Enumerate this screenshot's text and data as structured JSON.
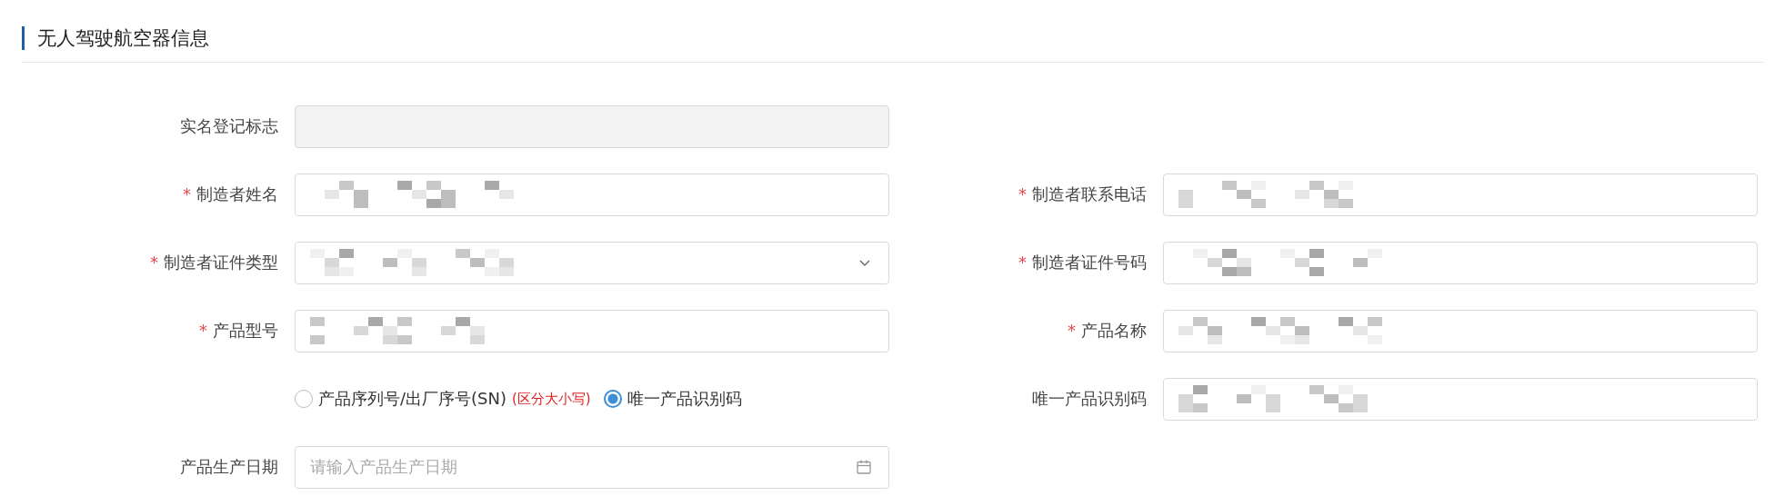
{
  "section": {
    "title": "无人驾驶航空器信息"
  },
  "rows": [
    {
      "left": {
        "kind": "disabled",
        "label": "实名登记标志"
      }
    },
    {
      "left": {
        "kind": "text",
        "label": "制造者姓名",
        "required_mark": "*",
        "masked": true
      },
      "right": {
        "kind": "text",
        "label": "制造者联系电话",
        "required_mark": "*",
        "masked": true
      }
    },
    {
      "left": {
        "kind": "select",
        "label": "制造者证件类型",
        "required_mark": "*",
        "masked": true
      },
      "right": {
        "kind": "text",
        "label": "制造者证件号码",
        "required_mark": "*",
        "masked": true
      }
    },
    {
      "left": {
        "kind": "text",
        "label": "产品型号",
        "required_mark": "*",
        "masked": true
      },
      "right": {
        "kind": "text",
        "label": "产品名称",
        "required_mark": "*",
        "masked": true
      }
    },
    {
      "left": {
        "kind": "radio",
        "options": [
          {
            "label": "产品序列号/出厂序号(SN)",
            "note": "(区分大小写)",
            "selected": false
          },
          {
            "label": "唯一产品识别码",
            "selected": true
          }
        ]
      },
      "right": {
        "kind": "text",
        "label": "唯一产品识别码",
        "masked": true
      }
    },
    {
      "left": {
        "kind": "date",
        "label": "产品生产日期",
        "placeholder": "请输入产品生产日期"
      }
    }
  ]
}
